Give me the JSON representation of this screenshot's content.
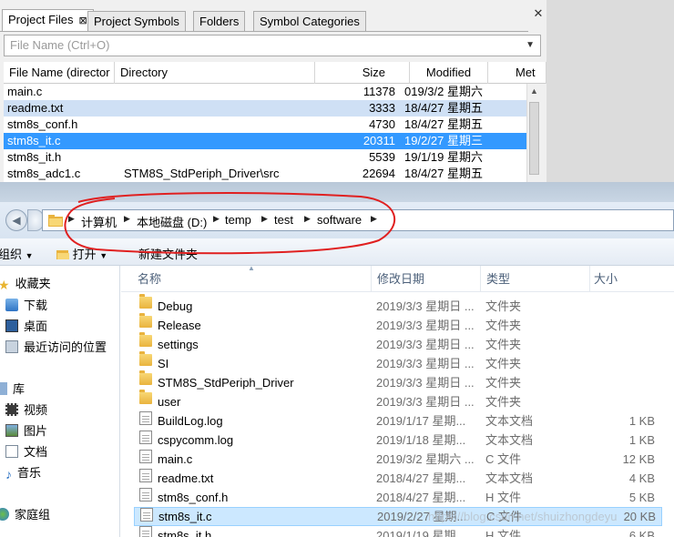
{
  "source_insight": {
    "tabs": [
      "Project Files",
      "Project Symbols",
      "Folders",
      "Symbol Categories"
    ],
    "tab_close": "⊠",
    "panel_close": "✕",
    "filter_placeholder": "File Name (Ctrl+O)",
    "columns": [
      "File Name (director",
      "Directory",
      "Size",
      "Modified",
      "Met"
    ],
    "rows": [
      {
        "name": "main.c",
        "dir": "",
        "size": "11378",
        "modified": "019/3/2 星期六"
      },
      {
        "name": "readme.txt",
        "dir": "",
        "size": "3333",
        "modified": "18/4/27 星期五"
      },
      {
        "name": "stm8s_conf.h",
        "dir": "",
        "size": "4730",
        "modified": "18/4/27 星期五"
      },
      {
        "name": "stm8s_it.c",
        "dir": "",
        "size": "20311",
        "modified": "19/2/27 星期三"
      },
      {
        "name": "stm8s_it.h",
        "dir": "",
        "size": "5539",
        "modified": "19/1/19 星期六"
      },
      {
        "name": "stm8s_adc1.c",
        "dir": "STM8S_StdPeriph_Driver\\src",
        "size": "22694",
        "modified": "18/4/27 星期五"
      }
    ]
  },
  "explorer": {
    "breadcrumb": [
      "计算机",
      "本地磁盘 (D:)",
      "temp",
      "test",
      "software"
    ],
    "toolbar": {
      "organize": "组织",
      "open": "打开",
      "new_folder": "新建文件夹"
    },
    "nav": {
      "favorites": "收藏夹",
      "favorites_items": [
        "下载",
        "桌面",
        "最近访问的位置"
      ],
      "libraries": "库",
      "libraries_items": [
        "视频",
        "图片",
        "文档",
        "音乐"
      ],
      "homegroup": "家庭组"
    },
    "columns": {
      "name": "名称",
      "date": "修改日期",
      "type": "类型",
      "size": "大小"
    },
    "files": [
      {
        "name": "Debug",
        "date": "2019/3/3 星期日 ...",
        "type": "文件夹",
        "size": "",
        "kind": "folder"
      },
      {
        "name": "Release",
        "date": "2019/3/3 星期日 ...",
        "type": "文件夹",
        "size": "",
        "kind": "folder"
      },
      {
        "name": "settings",
        "date": "2019/3/3 星期日 ...",
        "type": "文件夹",
        "size": "",
        "kind": "folder"
      },
      {
        "name": "SI",
        "date": "2019/3/3 星期日 ...",
        "type": "文件夹",
        "size": "",
        "kind": "folder"
      },
      {
        "name": "STM8S_StdPeriph_Driver",
        "date": "2019/3/3 星期日 ...",
        "type": "文件夹",
        "size": "",
        "kind": "folder"
      },
      {
        "name": "user",
        "date": "2019/3/3 星期日 ...",
        "type": "文件夹",
        "size": "",
        "kind": "folder"
      },
      {
        "name": "BuildLog.log",
        "date": "2019/1/17 星期...",
        "type": "文本文档",
        "size": "1 KB",
        "kind": "file"
      },
      {
        "name": "cspycomm.log",
        "date": "2019/1/18 星期...",
        "type": "文本文档",
        "size": "1 KB",
        "kind": "file"
      },
      {
        "name": "main.c",
        "date": "2019/3/2 星期六 ...",
        "type": "C 文件",
        "size": "12 KB",
        "kind": "file"
      },
      {
        "name": "readme.txt",
        "date": "2018/4/27 星期...",
        "type": "文本文档",
        "size": "4 KB",
        "kind": "file"
      },
      {
        "name": "stm8s_conf.h",
        "date": "2018/4/27 星期...",
        "type": "H 文件",
        "size": "5 KB",
        "kind": "file"
      },
      {
        "name": "stm8s_it.c",
        "date": "2019/2/27 星期...",
        "type": "C 文件",
        "size": "20 KB",
        "kind": "file"
      },
      {
        "name": "stm8s_it.h",
        "date": "2019/1/19 星期...",
        "type": "H 文件",
        "size": "6 KB",
        "kind": "file"
      }
    ],
    "watermark": "https://blog.csdn.net/shuizhongdeyu"
  }
}
